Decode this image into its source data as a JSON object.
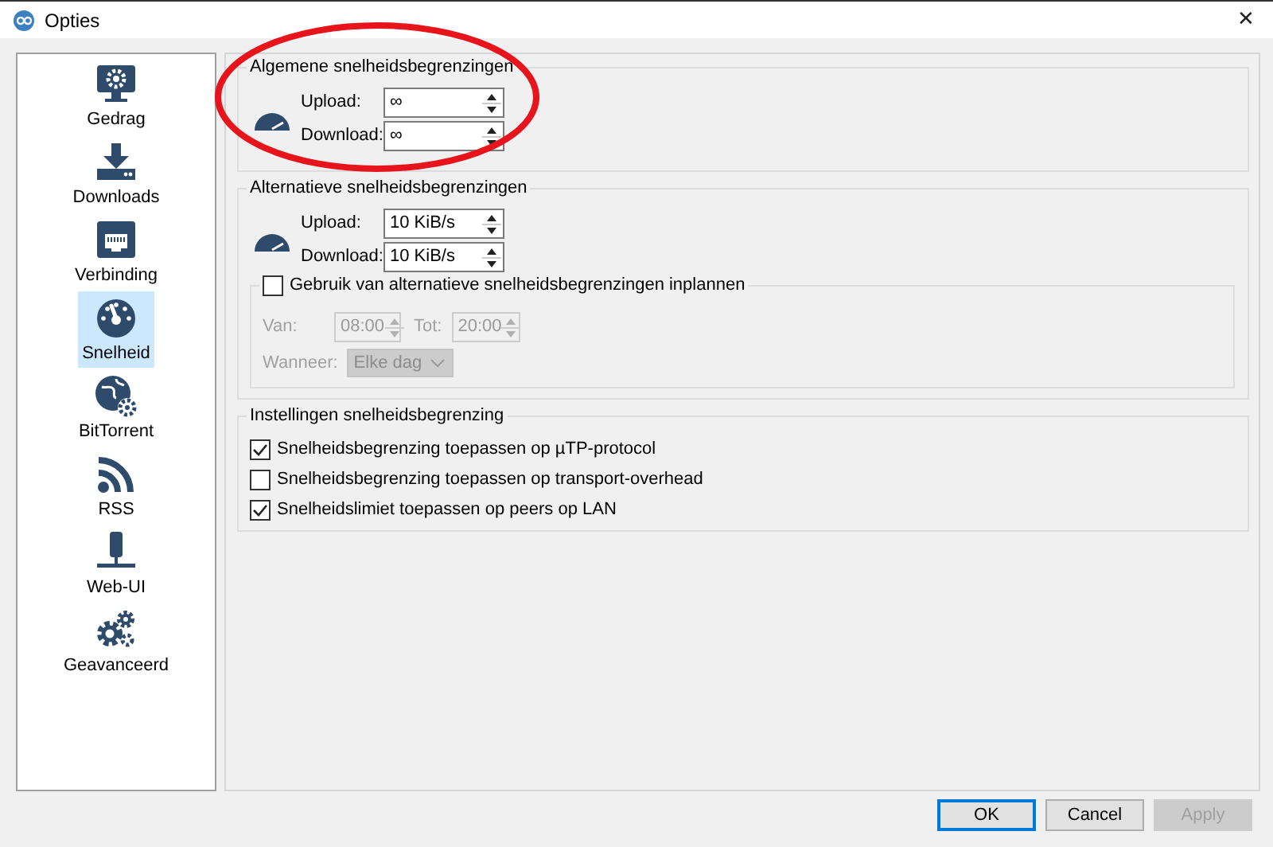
{
  "window": {
    "title": "Opties",
    "close_button": "✕"
  },
  "sidebar": {
    "items": [
      {
        "label": "Gedrag",
        "selected": false
      },
      {
        "label": "Downloads",
        "selected": false
      },
      {
        "label": "Verbinding",
        "selected": false
      },
      {
        "label": "Snelheid",
        "selected": true
      },
      {
        "label": "BitTorrent",
        "selected": false
      },
      {
        "label": "RSS",
        "selected": false
      },
      {
        "label": "Web-UI",
        "selected": false
      },
      {
        "label": "Geavanceerd",
        "selected": false
      }
    ]
  },
  "general_limits": {
    "title": "Algemene snelheidsbegrenzingen",
    "fields": [
      {
        "label": "Upload:",
        "value": "∞"
      },
      {
        "label": "Download:",
        "value": "∞"
      }
    ]
  },
  "alternative_limits": {
    "title": "Alternatieve snelheidsbegrenzingen",
    "fields": [
      {
        "label": "Upload:",
        "value": "10 KiB/s"
      },
      {
        "label": "Download:",
        "value": "10 KiB/s"
      }
    ],
    "schedule": {
      "label": "Gebruik van alternatieve snelheidsbegrenzingen inplannen",
      "checked": false,
      "from_label": "Van:",
      "from_value": "08:00",
      "to_label": "Tot:",
      "to_value": "20:00",
      "when_label": "Wanneer:",
      "when_value": "Elke dag"
    }
  },
  "limit_settings": {
    "title": "Instellingen snelheidsbegrenzing",
    "options": [
      {
        "label": "Snelheidsbegrenzing toepassen op µTP-protocol",
        "checked": true
      },
      {
        "label": "Snelheidsbegrenzing toepassen op transport-overhead",
        "checked": false
      },
      {
        "label": "Snelheidslimiet toepassen op peers op LAN",
        "checked": true
      }
    ]
  },
  "buttons": [
    {
      "label": "OK",
      "default": true,
      "disabled": false
    },
    {
      "label": "Cancel",
      "default": false,
      "disabled": false
    },
    {
      "label": "Apply",
      "default": false,
      "disabled": true
    }
  ]
}
